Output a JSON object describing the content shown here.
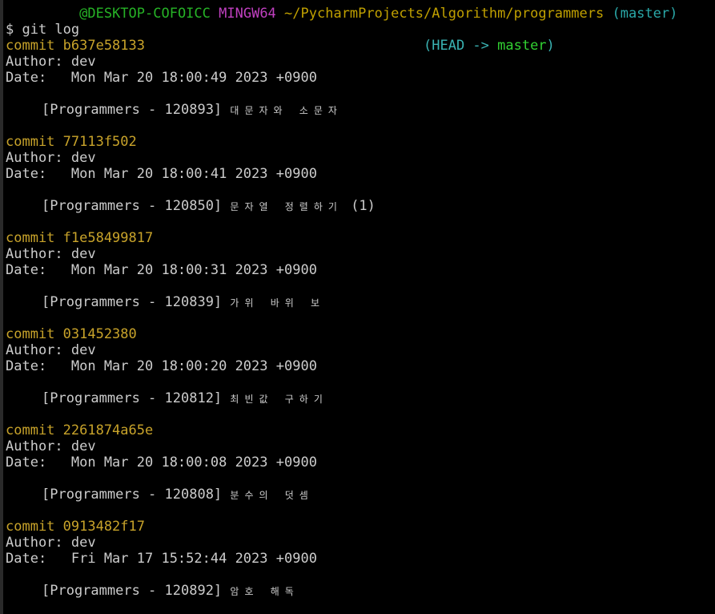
{
  "window": {
    "prompt": {
      "user_host": "@DESKTOP-COFOICC",
      "env": "MINGW64",
      "path": "~/PycharmProjects/Algorithm/programmers",
      "branch": "(master)"
    },
    "command": "$ git log"
  },
  "commits": [
    {
      "hash": "commit b637e58133",
      "ref_open": "(HEAD -> ",
      "ref_branch": "master",
      "ref_close": ")",
      "author": "Author: dev",
      "date": "Date:   Mon Mar 20 18:00:49 2023 +0900",
      "message_prefix": "[Programmers - 120893]",
      "message_ko": "대문자와 소문자"
    },
    {
      "hash": "commit 77113f502",
      "author": "Author: dev",
      "date": "Date:   Mon Mar 20 18:00:41 2023 +0900",
      "message_prefix": "[Programmers - 120850]",
      "message_ko": "문자열 정렬하기",
      "message_suffix": "(1)"
    },
    {
      "hash": "commit f1e58499817",
      "author": "Author: dev",
      "date": "Date:   Mon Mar 20 18:00:31 2023 +0900",
      "message_prefix": "[Programmers - 120839]",
      "message_ko": "가위 바위 보"
    },
    {
      "hash": "commit 031452380",
      "author": "Author: dev",
      "date": "Date:   Mon Mar 20 18:00:20 2023 +0900",
      "message_prefix": "[Programmers - 120812]",
      "message_ko": "최빈값 구하기"
    },
    {
      "hash": "commit 2261874a65e",
      "author": "Author: dev",
      "date": "Date:   Mon Mar 20 18:00:08 2023 +0900",
      "message_prefix": "[Programmers - 120808]",
      "message_ko": "분수의 덧셈"
    },
    {
      "hash": "commit 0913482f17",
      "author": "Author: dev",
      "date": "Date:   Fri Mar 17 15:52:44 2023 +0900",
      "message_prefix": "[Programmers - 120892]",
      "message_ko": "암호 해독"
    }
  ],
  "colors": {
    "background": "#000000",
    "text": "#cccccc",
    "commit_hash": "#c8a32a",
    "head_ref": "#3ab3b3",
    "master_ref": "#32d232",
    "user_host": "#26b226",
    "env": "#c040c0",
    "path": "#c0a000",
    "branch": "#2aa9a9"
  }
}
